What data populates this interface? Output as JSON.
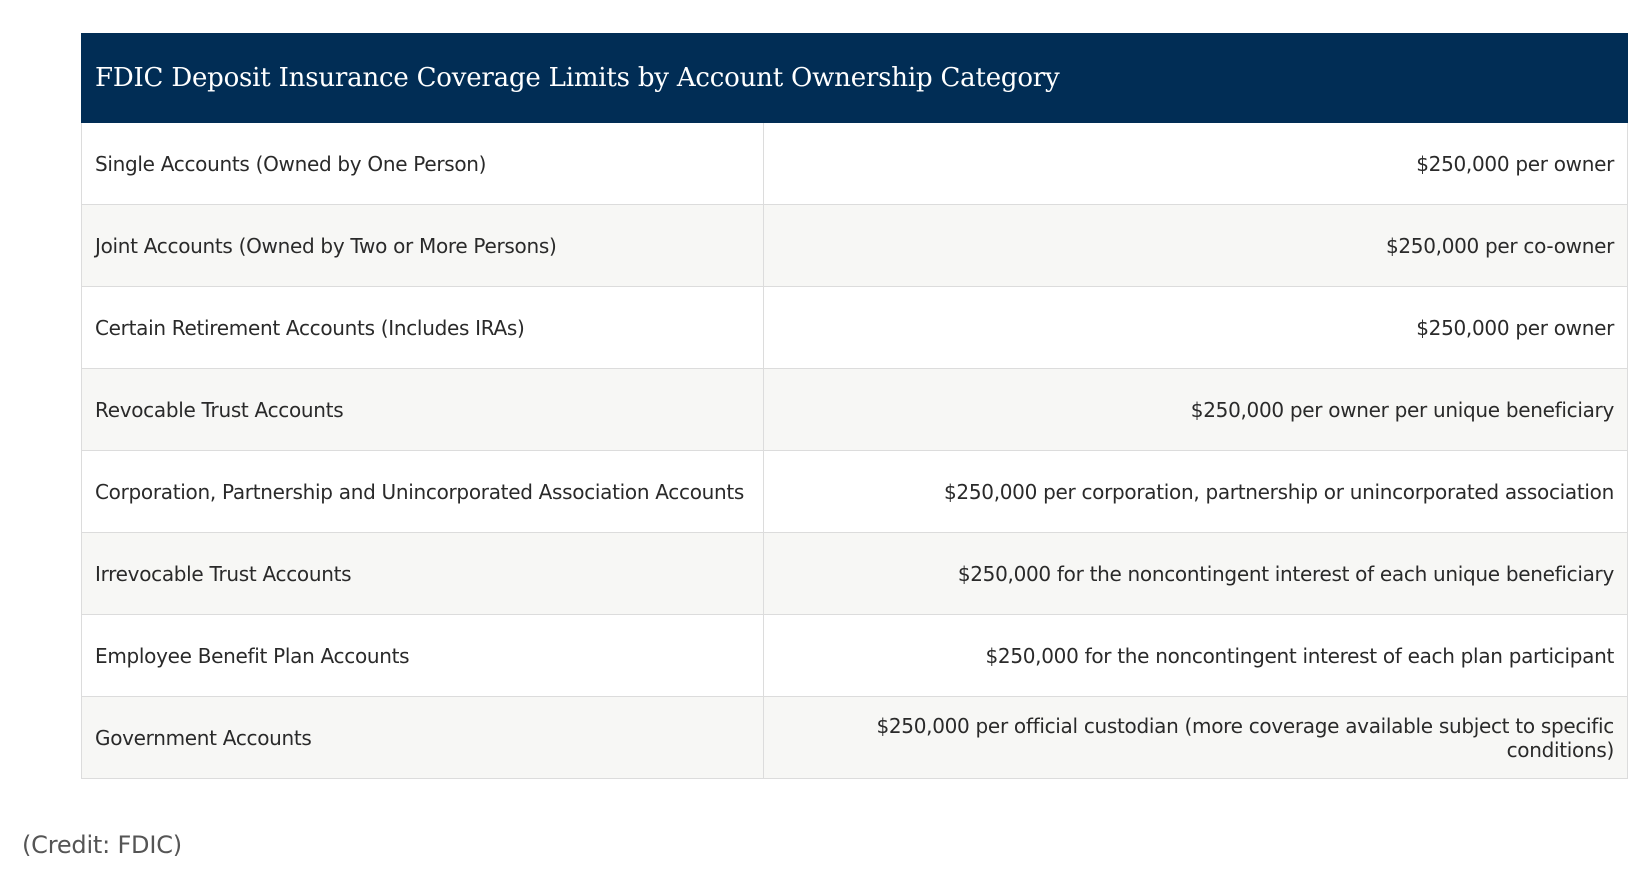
{
  "table": {
    "title": "FDIC Deposit Insurance Coverage Limits by Account Ownership Category",
    "rows": [
      {
        "category": "Single Accounts (Owned by One Person)",
        "limit": "$250,000 per owner"
      },
      {
        "category": "Joint Accounts (Owned by Two or More Persons)",
        "limit": "$250,000 per co-owner"
      },
      {
        "category": "Certain Retirement Accounts (Includes IRAs)",
        "limit": "$250,000 per owner"
      },
      {
        "category": "Revocable Trust Accounts",
        "limit": "$250,000 per owner per unique beneficiary"
      },
      {
        "category": "Corporation, Partnership and Unincorporated Association Accounts",
        "limit": "$250,000 per corporation, partnership or unincorporated association"
      },
      {
        "category": "Irrevocable Trust Accounts",
        "limit": "$250,000 for the noncontingent interest of each unique beneficiary"
      },
      {
        "category": "Employee Benefit Plan Accounts",
        "limit": "$250,000 for the noncontingent interest of each plan participant"
      },
      {
        "category": "Government Accounts",
        "limit": "$250,000 per official custodian (more coverage available subject to specific conditions)"
      }
    ]
  },
  "credit": "(Credit: FDIC)",
  "colors": {
    "header_bg": "#012d55",
    "header_text": "#ffffff",
    "row_alt_bg": "#f7f7f5",
    "border": "#dcdcdc"
  }
}
